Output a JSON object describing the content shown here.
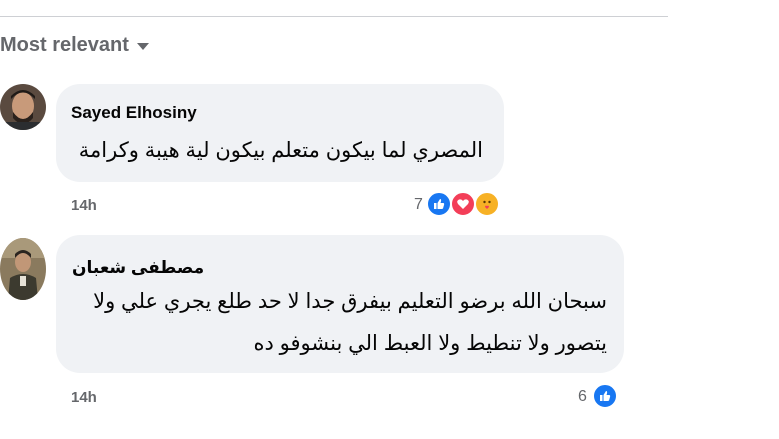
{
  "sort": {
    "label": "Most relevant"
  },
  "colors": {
    "bubble": "#f0f2f5",
    "secondary_text": "#65676b",
    "like_blue": "#1877f2",
    "love_red": "#f33e58",
    "care_yellow": "#f7b125"
  },
  "comments": [
    {
      "author": "Sayed Elhosiny",
      "text_lines": [
        "المصري لما بيكون متعلم بيكون لية هيبة وكرامة"
      ],
      "time": "14h",
      "reaction_count": "7",
      "reactions": [
        "like-icon",
        "love-icon",
        "care-icon"
      ]
    },
    {
      "author": "مصطفى شعبان",
      "text_lines": [
        "سبحان الله برضو التعليم بيفرق جدا لا حد طلع يجري علي ولا",
        "يتصور ولا تنطيط ولا العبط الي بنشوفو ده"
      ],
      "time": "14h",
      "reaction_count": "6",
      "reactions": [
        "like-icon"
      ]
    }
  ]
}
